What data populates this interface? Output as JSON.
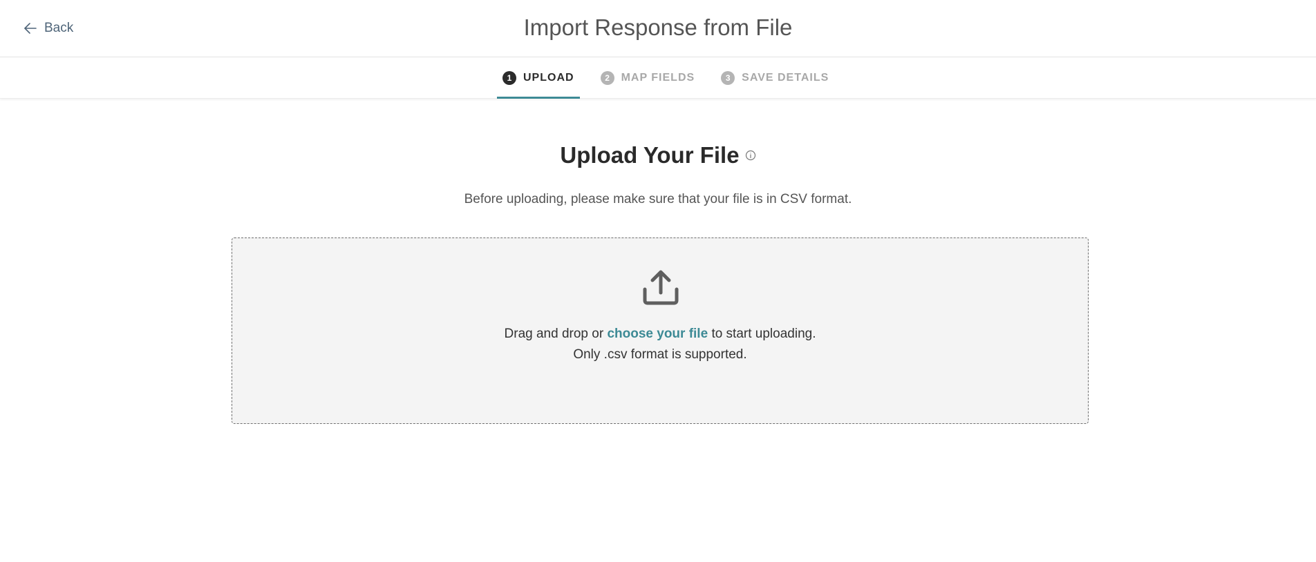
{
  "header": {
    "back_label": "Back",
    "title": "Import Response from File",
    "back_icon": "arrow-left-icon"
  },
  "steps": [
    {
      "number": "1",
      "label": "UPLOAD",
      "active": true
    },
    {
      "number": "2",
      "label": "MAP FIELDS",
      "active": false
    },
    {
      "number": "3",
      "label": "SAVE DETAILS",
      "active": false
    }
  ],
  "upload": {
    "heading": "Upload Your File",
    "info_icon": "info-icon",
    "subtitle": "Before uploading, please make sure that your file is in CSV format.",
    "dropzone": {
      "icon": "upload-icon",
      "text_before": "Drag and drop or",
      "link_text": "choose your file",
      "text_after": "to start uploading.",
      "note": "Only .csv format is supported."
    }
  },
  "colors": {
    "accent": "#3d8a95",
    "active_step": "#2b2b2b",
    "inactive_step": "#a8a8a8",
    "back_link": "#4e6478"
  }
}
